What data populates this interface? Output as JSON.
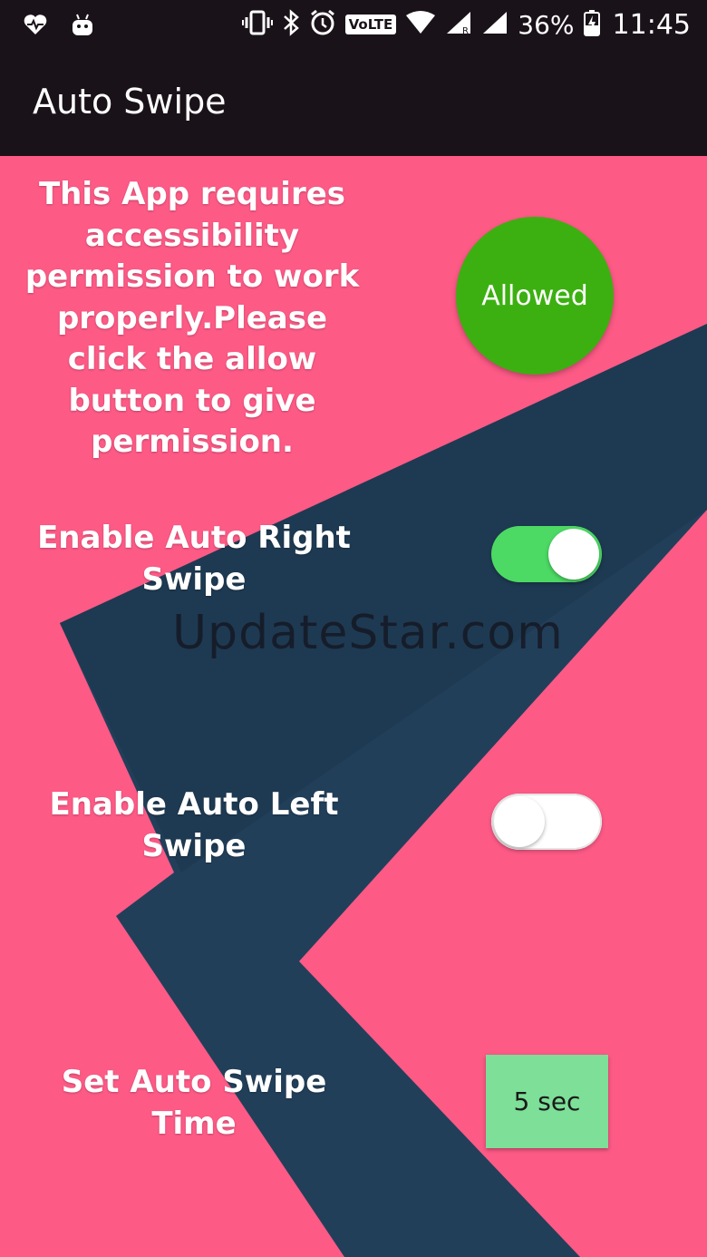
{
  "status_bar": {
    "icons_left": [
      "heart-monitor-icon",
      "android-icon"
    ],
    "icons_right": [
      "vibrate-icon",
      "bluetooth-icon",
      "alarm-icon",
      "volte-badge",
      "wifi-icon",
      "signal-r-icon",
      "signal-icon",
      "battery-charging-icon"
    ],
    "volte": "VoLTE",
    "battery": "36%",
    "time": "11:45"
  },
  "app_bar": {
    "title": "Auto Swipe"
  },
  "permission": {
    "message": "This App requires accessibility permission to work properly.Please click the allow button to give permission.",
    "button_label": "Allowed",
    "button_color": "#3cb011"
  },
  "settings": {
    "right_swipe": {
      "label": "Enable Auto Right Swipe",
      "enabled": true
    },
    "left_swipe": {
      "label": "Enable Auto Left Swipe",
      "enabled": false
    },
    "swipe_time": {
      "label": "Set Auto Swipe Time",
      "value": "5 sec"
    }
  },
  "watermark": "UpdateStar.com",
  "colors": {
    "background": "#fd5a86",
    "app_bar": "#1a1219",
    "accent_dark": "#223f5a",
    "toggle_on": "#4cd964",
    "time_button": "#7ddf98"
  }
}
